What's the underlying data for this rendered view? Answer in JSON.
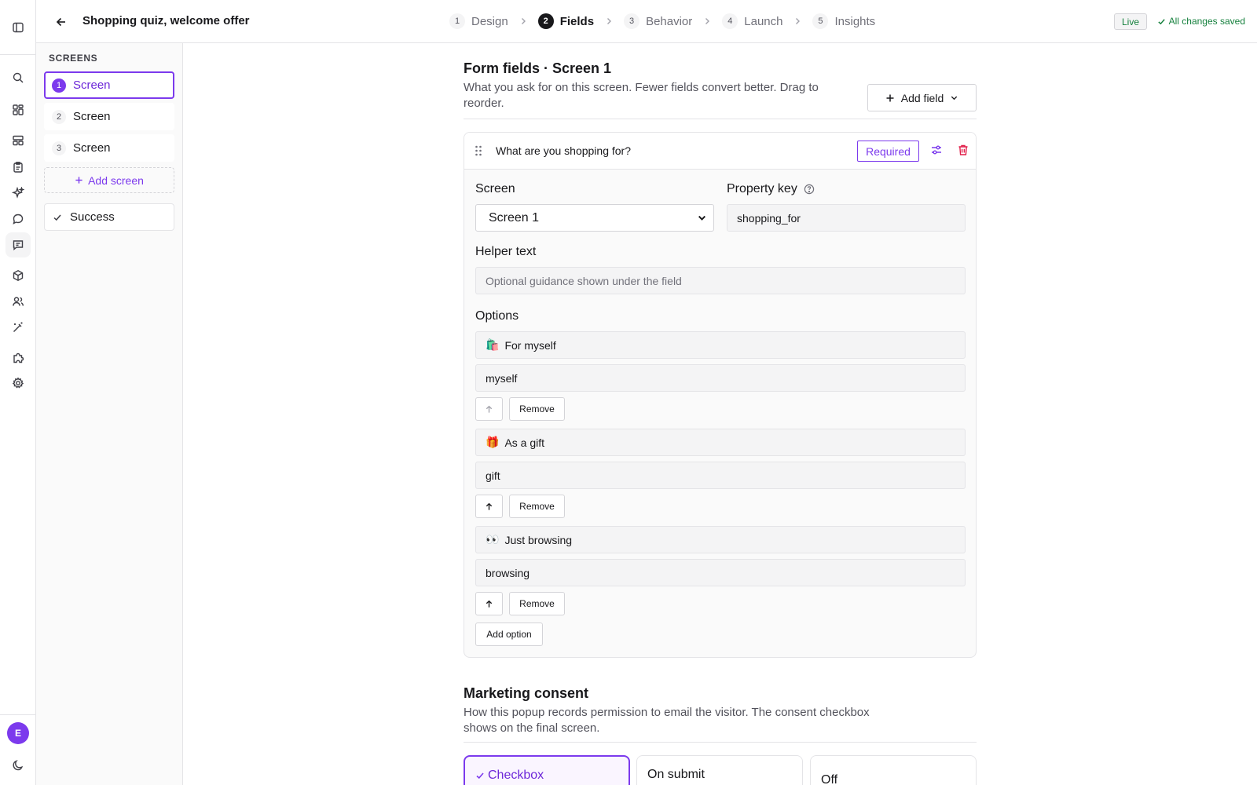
{
  "app": {
    "title": "Shopping quiz, welcome offer"
  },
  "steps": [
    {
      "num": "1",
      "label": "Design"
    },
    {
      "num": "2",
      "label": "Fields"
    },
    {
      "num": "3",
      "label": "Behavior"
    },
    {
      "num": "4",
      "label": "Launch"
    },
    {
      "num": "5",
      "label": "Insights"
    }
  ],
  "status": {
    "live": "Live",
    "saved": "All changes saved"
  },
  "rail": {
    "avatar_initial": "E",
    "icons": [
      "panel-toggle-icon",
      "search-icon",
      "dashboard-icon",
      "layout-icon",
      "clipboard-icon",
      "sparkles-icon",
      "chat-bubble-icon",
      "message-square-icon",
      "package-icon",
      "users-icon",
      "magic-wand-icon",
      "puzzle-icon",
      "settings-icon",
      "moon-icon"
    ]
  },
  "screens": {
    "title": "SCREENS",
    "items": [
      {
        "num": "1",
        "label": "Screen"
      },
      {
        "num": "2",
        "label": "Screen"
      },
      {
        "num": "3",
        "label": "Screen"
      }
    ],
    "add_label": "Add screen",
    "success_label": "Success"
  },
  "form": {
    "title": "Form fields · Screen 1",
    "description": "What you ask for on this screen. Fewer fields convert better. Drag to reorder.",
    "add_field_label": "Add field",
    "field": {
      "name": "What are you shopping for?",
      "required_label": "Required",
      "screen_label": "Screen",
      "screen_value": "Screen 1",
      "property_key_label": "Property key",
      "property_key_value": "shopping_for",
      "helper_label": "Helper text",
      "helper_placeholder": "Optional guidance shown under the field",
      "options_label": "Options",
      "options": [
        {
          "emoji": "🛍️",
          "label": "For myself",
          "value": "myself"
        },
        {
          "emoji": "🎁",
          "label": "As a gift",
          "value": "gift"
        },
        {
          "emoji": "👀",
          "label": "Just browsing",
          "value": "browsing"
        }
      ],
      "remove_label": "Remove",
      "add_option_label": "Add option"
    }
  },
  "consent": {
    "title": "Marketing consent",
    "description": "How this popup records permission to email the visitor. The consent checkbox shows on the final screen.",
    "options": [
      {
        "label": "Checkbox",
        "selected": true
      },
      {
        "label": "On submit",
        "selected": false
      },
      {
        "label": "Off",
        "selected": false
      }
    ]
  },
  "colors": {
    "accent": "#7c3aed",
    "success": "#15803d",
    "danger": "#e11d48"
  }
}
